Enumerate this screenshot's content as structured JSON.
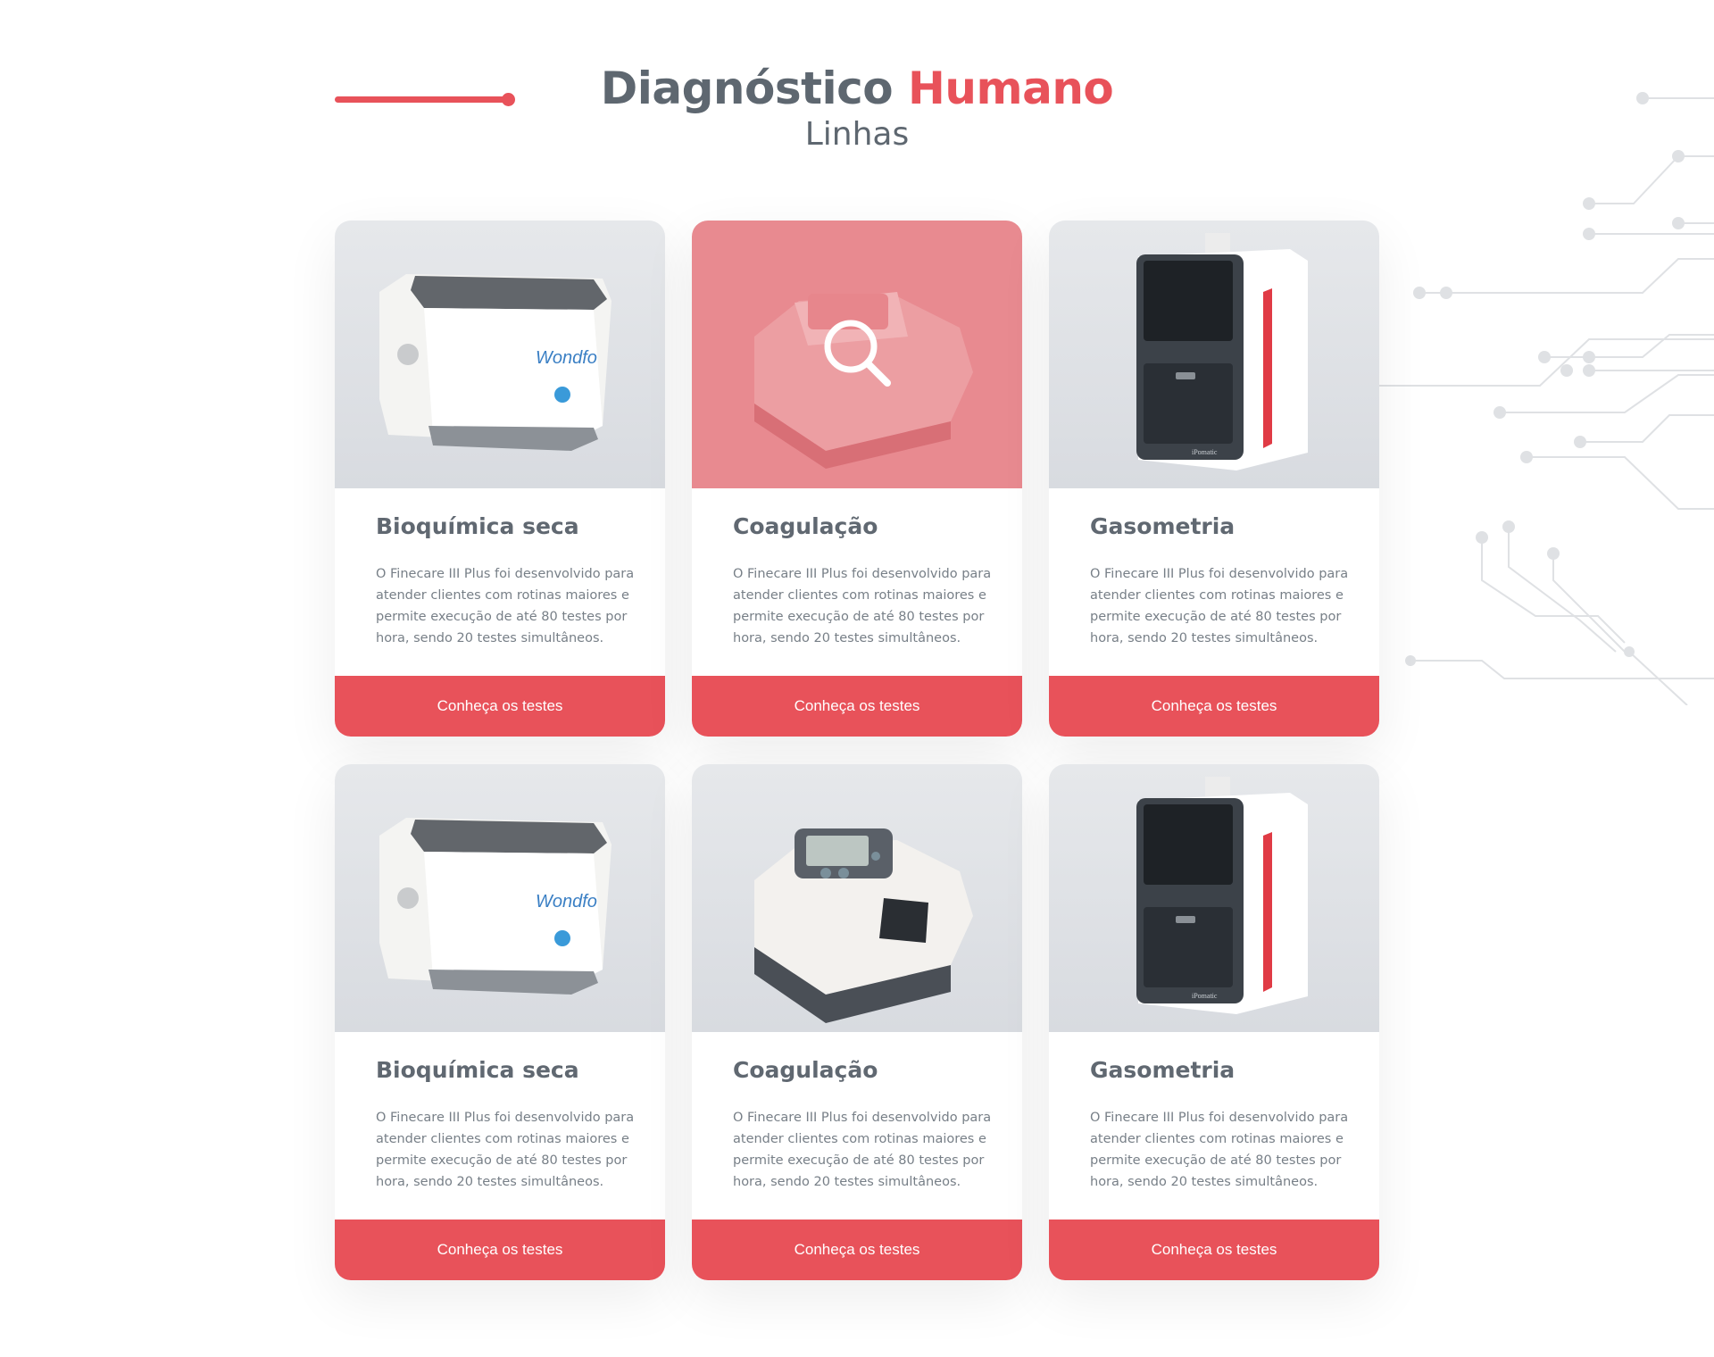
{
  "header": {
    "title_main": "Diagnóstico",
    "title_accent": "Humano",
    "subtitle": "Linhas"
  },
  "colors": {
    "accent": "#e8525a",
    "text": "#5e6770",
    "hover_overlay": "#e88a90"
  },
  "cards": [
    {
      "name": "Bioquímica seca",
      "description": "O Finecare III Plus foi desenvolvido para atender clientes com rotinas maiores e permite execução de até 80 testes por hora, sendo 20 testes simultâneos.",
      "button": "Conheça os testes",
      "device": "wondfo-analyzer",
      "brand": "Wondfo",
      "hovered": false
    },
    {
      "name": "Coagulação",
      "description": "O Finecare III Plus foi desenvolvido para atender clientes com rotinas maiores e permite execução de até 80 testes por hora, sendo 20 testes simultâneos.",
      "button": "Conheça os testes",
      "device": "coagulation-device",
      "hovered": true,
      "overlay_icon": "search-icon"
    },
    {
      "name": "Gasometria",
      "description": "O Finecare III Plus foi desenvolvido para atender clientes com rotinas maiores e permite execução de até 80 testes por hora, sendo 20 testes simultâneos.",
      "button": "Conheça os testes",
      "device": "ipomatic-analyzer",
      "brand": "iPomatic",
      "hovered": false
    },
    {
      "name": "Bioquímica seca",
      "description": "O Finecare III Plus foi desenvolvido para atender clientes com rotinas maiores e permite execução de até 80 testes por hora, sendo 20 testes simultâneos.",
      "button": "Conheça os testes",
      "device": "wondfo-analyzer",
      "brand": "Wondfo",
      "hovered": false
    },
    {
      "name": "Coagulação",
      "description": "O Finecare III Plus foi desenvolvido para atender clientes com rotinas maiores e permite execução de até 80 testes por hora, sendo 20 testes simultâneos.",
      "button": "Conheça os testes",
      "device": "coagulation-device",
      "hovered": false
    },
    {
      "name": "Gasometria",
      "description": "O Finecare III Plus foi desenvolvido para atender clientes com rotinas maiores e permite execução de até 80 testes por hora, sendo 20 testes simultâneos.",
      "button": "Conheça os testes",
      "device": "ipomatic-analyzer",
      "brand": "iPomatic",
      "hovered": false
    }
  ]
}
